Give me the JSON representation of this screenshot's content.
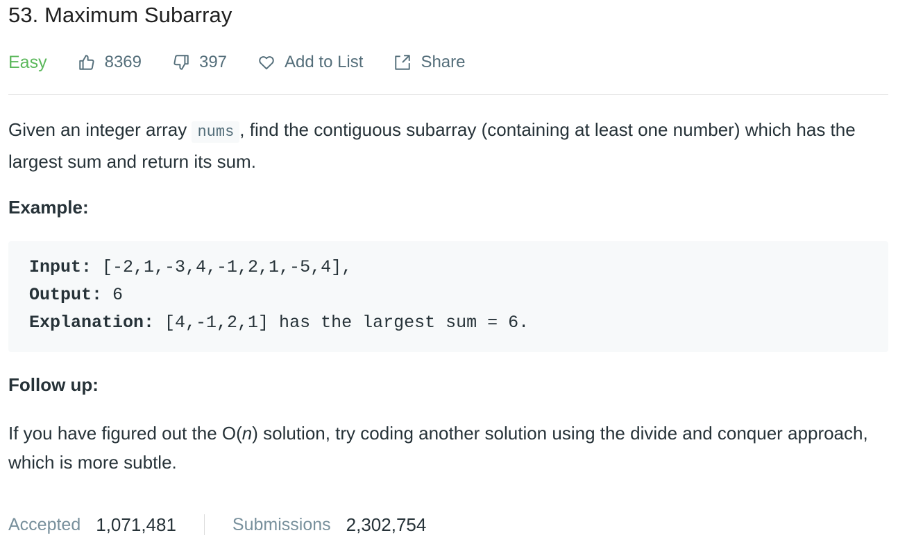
{
  "problem": {
    "title": "53. Maximum Subarray",
    "difficulty": "Easy",
    "likes": "8369",
    "dislikes": "397",
    "add_to_list_label": "Add to List",
    "share_label": "Share"
  },
  "description": {
    "text_before_code": "Given an integer array ",
    "inline_code": "nums",
    "text_after_code": ", find the contiguous subarray (containing at least one number) which has the largest sum and return its sum."
  },
  "example": {
    "label": "Example:",
    "input_label": "Input:",
    "input_value": " [-2,1,-3,4,-1,2,1,-5,4],",
    "output_label": "Output:",
    "output_value": " 6",
    "explanation_label": "Explanation:",
    "explanation_value": " [4,-1,2,1] has the largest sum = 6."
  },
  "followup": {
    "label": "Follow up:",
    "text_before_n": "If you have figured out the O(",
    "n": "n",
    "text_after_n": ") solution, try coding another solution using the divide and conquer approach, which is more subtle."
  },
  "stats": {
    "accepted_label": "Accepted",
    "accepted_value": "1,071,481",
    "submissions_label": "Submissions",
    "submissions_value": "2,302,754"
  },
  "colors": {
    "easy": "#5cb85c",
    "muted": "#546e7a",
    "text": "#263238",
    "code_bg": "#f7f9fa"
  },
  "icons": {
    "like": "thumbs-up-icon",
    "dislike": "thumbs-down-icon",
    "add_to_list": "heart-icon",
    "share": "share-icon"
  }
}
